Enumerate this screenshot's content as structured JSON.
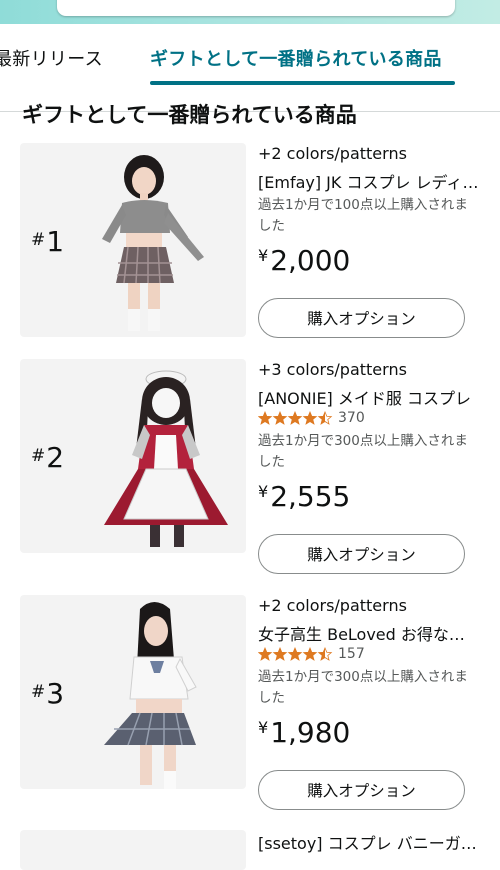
{
  "tabs": {
    "previous_label": "最新リリース",
    "active_label": "ギフトとして一番贈られている商品"
  },
  "section_title": "ギフトとして一番贈られている商品",
  "items": [
    {
      "rank_symbol": "#",
      "rank_number": "1",
      "colors": "+2 colors/patterns",
      "title": "[Emfay] JK コスプレ レディース",
      "purchased": "過去1か月で100点以上購入されました",
      "currency": "¥",
      "price": "2,000",
      "button": "購入オプション",
      "image_desc": "gray-sweater-outfit"
    },
    {
      "rank_symbol": "#",
      "rank_number": "2",
      "colors": "+3 colors/patterns",
      "title": "[ANONIE] メイド服 コスプレ",
      "rating": 4.5,
      "rating_count": "370",
      "purchased": "過去1か月で300点以上購入されました",
      "currency": "¥",
      "price": "2,555",
      "button": "購入オプション",
      "image_desc": "red-maid-outfit"
    },
    {
      "rank_symbol": "#",
      "rank_number": "3",
      "colors": "+2 colors/patterns",
      "title": "女子高生 BeLoved お得なセット",
      "rating": 4.5,
      "rating_count": "157",
      "purchased": "過去1か月で300点以上購入されました",
      "currency": "¥",
      "price": "1,980",
      "button": "購入オプション",
      "image_desc": "school-uniform-outfit"
    }
  ],
  "partial_item_title": "[ssetoy] コスプレ バニーガール",
  "colors": {
    "accent": "#007185",
    "star": "#de7921",
    "text": "#0f1111",
    "muted": "#565959"
  }
}
